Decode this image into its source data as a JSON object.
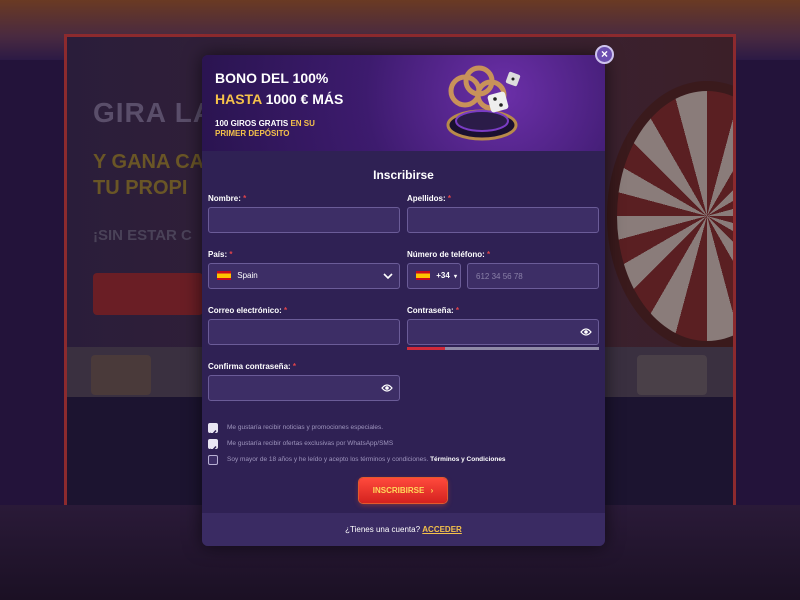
{
  "background": {
    "hero_title": "GIRA LA",
    "hero_subtitle_1": "Y GANA CA",
    "hero_subtitle_2": "TU PROPI",
    "hero_line": "¡SIN ESTAR C"
  },
  "banner": {
    "line1": "BONO DEL 100%",
    "line2_gold": "HASTA",
    "line2_white": "1000 € MÁS",
    "line3_white": "100 GIROS GRATIS",
    "line3_gold": "EN SU PRIMER DEPÓSITO"
  },
  "close_label": "×",
  "form": {
    "title": "Inscribirse",
    "required_mark": "*",
    "fields": {
      "first_name": {
        "label": "Nombre:",
        "value": ""
      },
      "last_name": {
        "label": "Apellidos:",
        "value": ""
      },
      "country": {
        "label": "País:",
        "value": "Spain"
      },
      "phone": {
        "label": "Número de teléfono:",
        "prefix": "+34",
        "placeholder": "612 34 56 78"
      },
      "email": {
        "label": "Correo electrónico:",
        "value": ""
      },
      "password": {
        "label": "Contraseña:",
        "value": "",
        "strength": 0.2
      },
      "confirm_password": {
        "label": "Confirma contraseña:",
        "value": ""
      }
    },
    "checkboxes": [
      {
        "label": "Me gustaría recibir noticias y promociones especiales.",
        "checked": true
      },
      {
        "label": "Me gustaría recibir ofertas exclusivas por WhatsApp/SMS",
        "checked": true
      },
      {
        "label": "Soy mayor de 18 años y he leído y acepto los términos y condiciones.",
        "link": "Términos y Condiciones",
        "checked": false
      }
    ],
    "submit_label": "INSCRIBIRSE",
    "submit_arrow": "›"
  },
  "footer": {
    "question": "¿Tienes una cuenta?",
    "login_link": "ACCEDER"
  },
  "colors": {
    "modal_bg": "#2f2154",
    "accent_gold": "#f5c24a",
    "submit_red": "#d4221f",
    "required_red": "#e0434a"
  }
}
